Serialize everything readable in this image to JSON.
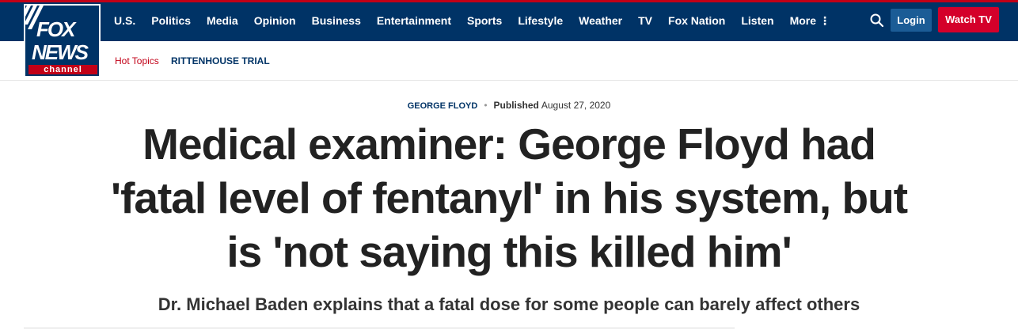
{
  "brand": {
    "logo_line1": "FOX",
    "logo_line2": "NEWS",
    "logo_line3": "channel",
    "colors": {
      "nav_bg": "#003366",
      "accent_red": "#c20017",
      "login_blue": "#1b5c96",
      "watch_red": "#d4002a"
    }
  },
  "nav": {
    "items": [
      "U.S.",
      "Politics",
      "Media",
      "Opinion",
      "Business",
      "Entertainment",
      "Sports",
      "Lifestyle",
      "Weather",
      "TV",
      "Fox Nation",
      "Listen"
    ],
    "more_label": "More",
    "more_icon": "vertical-dots-icon",
    "search_icon": "search-icon",
    "login_label": "Login",
    "watch_label": "Watch TV"
  },
  "hot_topics": {
    "label": "Hot Topics",
    "links": [
      "RITTENHOUSE TRIAL"
    ]
  },
  "article": {
    "category": "GEORGE FLOYD",
    "published_label": "Published",
    "published_date": "August 27, 2020",
    "headline": "Medical examiner: George Floyd had 'fatal level of fentanyl' in his system, but is 'not saying this killed him'",
    "subhead": "Dr. Michael Baden explains that a fatal dose for some people can barely affect others"
  }
}
